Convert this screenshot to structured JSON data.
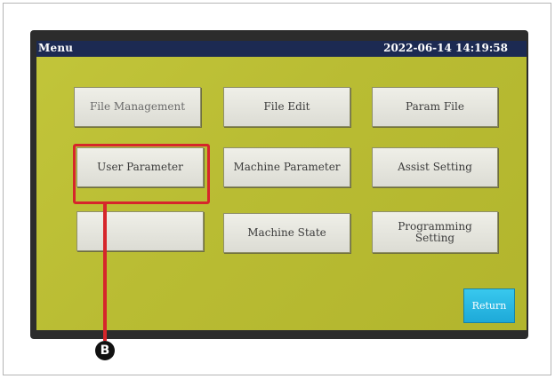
{
  "titlebar": {
    "title": "Menu",
    "datetime": "2022-06-14 14:19:58"
  },
  "menu": {
    "buttons": [
      {
        "label": "File Management"
      },
      {
        "label": "File Edit"
      },
      {
        "label": "Param File"
      },
      {
        "label": "User Parameter"
      },
      {
        "label": "Machine Parameter"
      },
      {
        "label": "Assist Setting"
      },
      {
        "label": ""
      },
      {
        "label": "Machine State"
      },
      {
        "label": "Programming\nSetting"
      }
    ],
    "return_label": "Return"
  },
  "annotation": {
    "marker_label": "B",
    "highlight_color": "#d6262b"
  },
  "colors": {
    "screen_background": "#b9bc33",
    "titlebar": "#1c2a52",
    "return_button": "#2bb8e3"
  }
}
